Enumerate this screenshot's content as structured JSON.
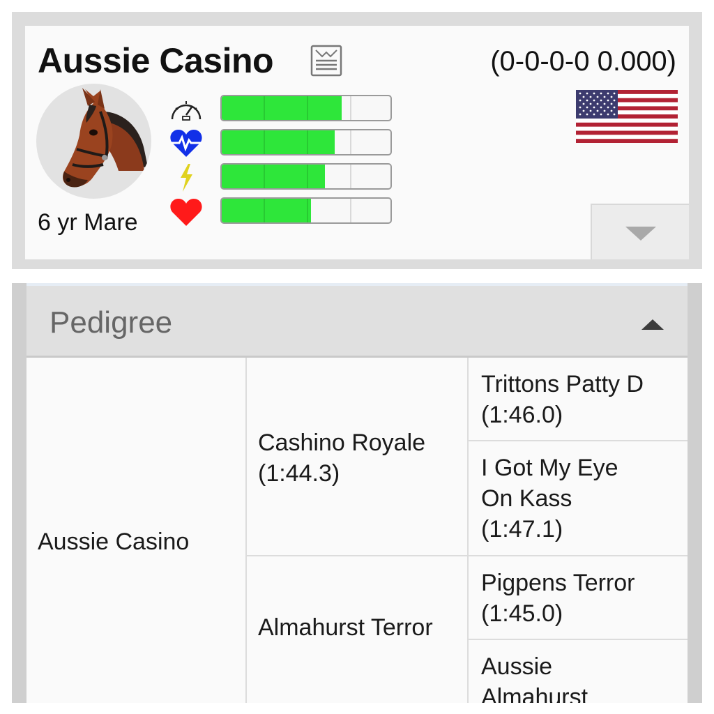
{
  "horse": {
    "name": "Aussie Casino",
    "record": "(0-0-0-0 0.000)",
    "age_gender": "6 yr Mare",
    "flag_icon": "us-flag-icon",
    "report_icon": "report-icon",
    "stats": [
      {
        "name": "speed",
        "icon": "speedometer-icon",
        "fill_fraction": 0.71
      },
      {
        "name": "stamina",
        "icon": "heart-rate-icon",
        "fill_fraction": 0.67
      },
      {
        "name": "energy",
        "icon": "lightning-icon",
        "fill_fraction": 0.61
      },
      {
        "name": "health",
        "icon": "heart-icon",
        "fill_fraction": 0.53
      }
    ],
    "stat_fill_color": "#2ee63a"
  },
  "pedigree": {
    "title": "Pedigree",
    "horse": "Aussie Casino",
    "sire": {
      "name": "Cashino Royale",
      "time": "(1:44.3)"
    },
    "dam": {
      "name": "Almahurst Terror"
    },
    "sire_sire": {
      "name": "Trittons Patty D",
      "time": "(1:46.0)"
    },
    "sire_dam": {
      "name": "I Got My Eye On Kass",
      "time": "(1:47.1)"
    },
    "dam_sire": {
      "name": "Pigpens Terror",
      "time": "(1:45.0)"
    },
    "dam_dam": {
      "name": "Aussie Almahurst"
    }
  }
}
